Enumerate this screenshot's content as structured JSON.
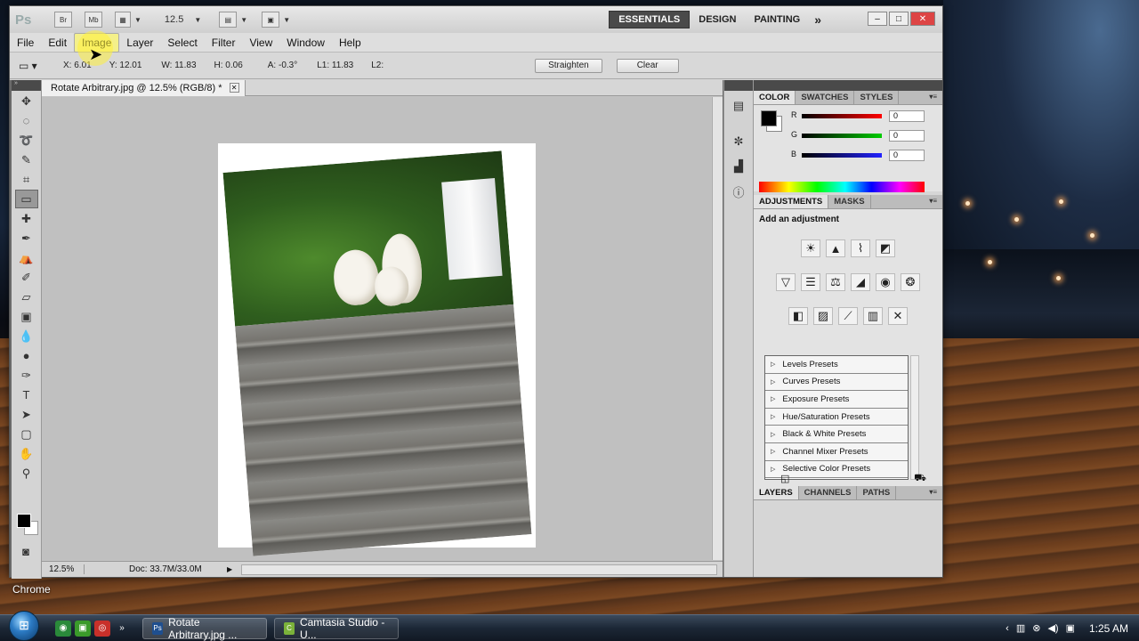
{
  "ps": {
    "logo": "Ps",
    "appbar": {
      "bridge": "Br",
      "minibridge": "Mb",
      "zoom": "12.5"
    },
    "workspaces": [
      "ESSENTIALS",
      "DESIGN",
      "PAINTING"
    ],
    "workspace_more": "»",
    "window_controls": {
      "minimize": "–",
      "maximize": "□",
      "close": "✕"
    }
  },
  "menu": [
    "File",
    "Edit",
    "Image",
    "Layer",
    "Select",
    "Filter",
    "View",
    "Window",
    "Help"
  ],
  "options": {
    "x": "X: 6.01",
    "y": "Y: 12.01",
    "w": "W: 11.83",
    "h": "H: 0.06",
    "a": "A: -0.3°",
    "l1": "L1: 11.83",
    "l2": "L2:",
    "straighten": "Straighten",
    "clear": "Clear"
  },
  "document": {
    "tab_title": "Rotate Arbitrary.jpg @ 12.5% (RGB/8) *",
    "status_zoom": "12.5%",
    "doc_info": "Doc: 33.7M/33.0M"
  },
  "color_panel": {
    "tabs": [
      "COLOR",
      "SWATCHES",
      "STYLES"
    ],
    "r_label": "R",
    "g_label": "G",
    "b_label": "B",
    "r_value": "0",
    "g_value": "0",
    "b_value": "0"
  },
  "adjustments_panel": {
    "tabs": [
      "ADJUSTMENTS",
      "MASKS"
    ],
    "title": "Add an adjustment",
    "presets": [
      "Levels Presets",
      "Curves Presets",
      "Exposure Presets",
      "Hue/Saturation Presets",
      "Black & White Presets",
      "Channel Mixer Presets",
      "Selective Color Presets"
    ]
  },
  "layers_panel": {
    "tabs": [
      "LAYERS",
      "CHANNELS",
      "PATHS"
    ]
  },
  "desktop": {
    "label": "Chrome"
  },
  "taskbar": {
    "tasks": [
      "Rotate Arbitrary.jpg ...",
      "Camtasia Studio - U..."
    ],
    "clock": "1:25 AM"
  }
}
